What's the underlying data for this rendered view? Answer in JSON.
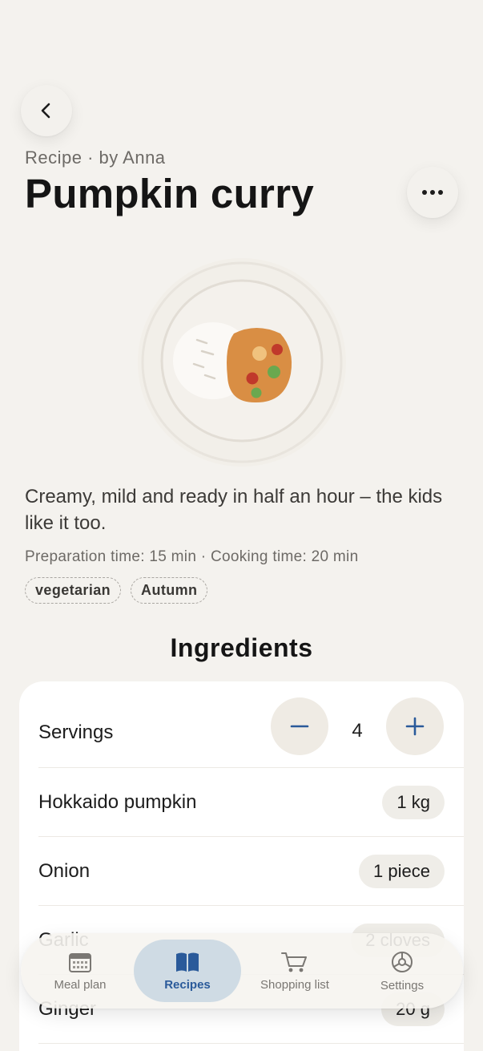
{
  "header": {
    "subtitle": "Recipe · by Anna",
    "title": "Pumpkin curry"
  },
  "recipe": {
    "description": "Creamy, mild and ready in half an hour – the kids like it too.",
    "times": "Preparation time: 15 min · Cooking time: 20 min",
    "tags": [
      "vegetarian",
      "Autumn"
    ]
  },
  "ingredients": {
    "title": "Ingredients",
    "servings_label": "Servings",
    "servings_value": "4",
    "items": [
      {
        "name": "Hokkaido pumpkin",
        "amount": "1 kg"
      },
      {
        "name": "Onion",
        "amount": "1 piece"
      },
      {
        "name": "Garlic",
        "amount": "2 cloves"
      },
      {
        "name": "Ginger",
        "amount": "20 g"
      }
    ]
  },
  "tabbar": {
    "tabs": [
      {
        "label": "Meal plan",
        "icon": "calendar-icon"
      },
      {
        "label": "Recipes",
        "icon": "book-icon",
        "active": true
      },
      {
        "label": "Shopping list",
        "icon": "cart-icon"
      },
      {
        "label": "Settings",
        "icon": "gear-icon"
      }
    ]
  },
  "colors": {
    "background": "#f4f2ee",
    "accent": "#2a5a9a",
    "curry": "#d98e44"
  }
}
